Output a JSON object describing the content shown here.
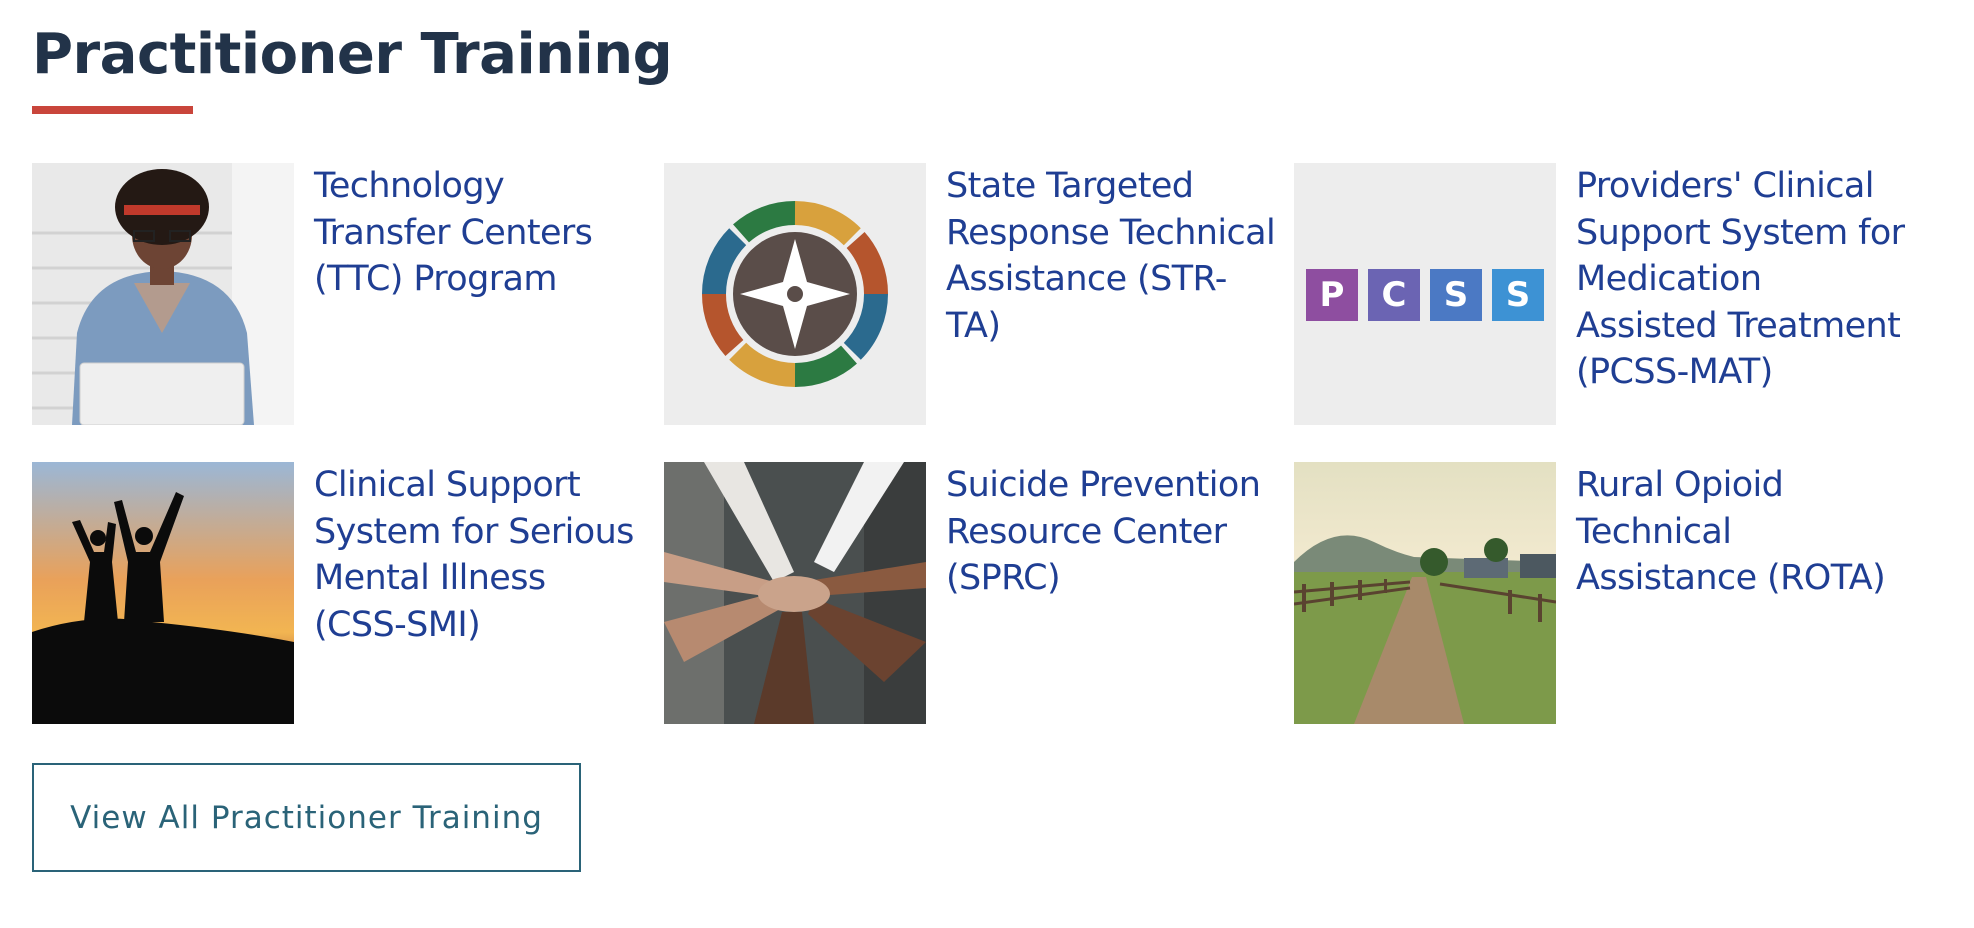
{
  "section": {
    "title": "Practitioner Training",
    "accent_color": "#c9453b",
    "title_color": "#223349",
    "link_color": "#1f3e93"
  },
  "cards": [
    {
      "label": "Technology Transfer Centers (TTC) Program",
      "image": "woman-with-laptop-photo"
    },
    {
      "label": "State Targeted Response Technical Assistance (STR-TA)",
      "image": "compass-logo"
    },
    {
      "label": "Providers' Clinical Support System for Medication Assisted Treatment (PCSS-MAT)",
      "image": "pcss-logo",
      "logo_letters": [
        "P",
        "C",
        "S",
        "S"
      ]
    },
    {
      "label": "Clinical Support System for Serious Mental Illness (CSS-SMI)",
      "image": "sunset-silhouette-photo"
    },
    {
      "label": "Suicide Prevention Resource Center (SPRC)",
      "image": "stacked-hands-photo"
    },
    {
      "label": "Rural Opioid Technical Assistance (ROTA)",
      "image": "rural-road-photo"
    }
  ],
  "view_all": {
    "label": "View All Practitioner Training",
    "border_color": "#2a6378"
  }
}
